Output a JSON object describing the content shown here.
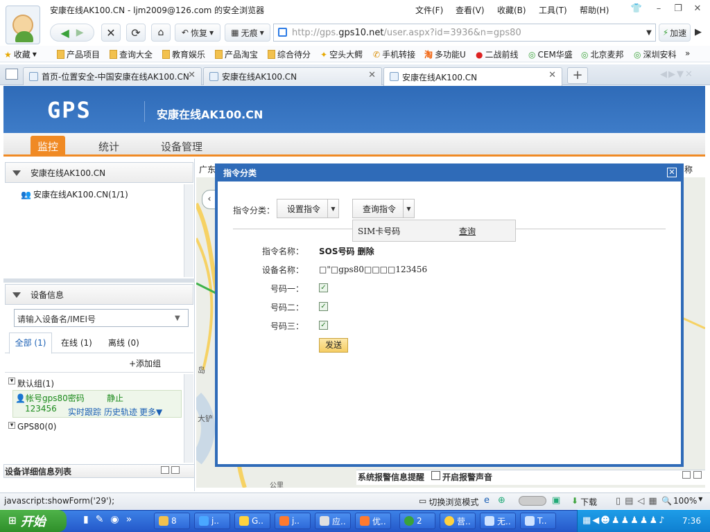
{
  "window": {
    "title": "安康在线AK100.CN - ljm2009@126.com 的安全浏览器",
    "menu": [
      "文件(F)",
      "查看(V)",
      "收藏(B)",
      "工具(T)",
      "帮助(H)"
    ]
  },
  "nav": {
    "restore_label": "恢复",
    "notrace_label": "无痕",
    "url_prefix": "http://gps.",
    "url_domain": "gps10.net",
    "url_path": "/user.aspx?id=3936&n=gps80",
    "accelerate_label": "加速"
  },
  "favorites": {
    "label": "收藏",
    "items": [
      "产品项目",
      "查询大全",
      "教育娱乐",
      "产品淘宝",
      "综合待分",
      "空头大鳄",
      "手机转接",
      "多功能U",
      "二战前线",
      "CEM华盛",
      "北京麦邦",
      "深圳安科"
    ]
  },
  "tabs": [
    {
      "label": "首页-位置安全-中国安康在线AK100.CN"
    },
    {
      "label": "安康在线AK100.CN"
    },
    {
      "label": "安康在线AK100.CN"
    }
  ],
  "page": {
    "logo": "GPS",
    "site_title": "安康在线AK100.CN",
    "nav": [
      "监控",
      "统计",
      "设备管理"
    ]
  },
  "left": {
    "tree_header": "安康在线AK100.CN",
    "tree_item": "安康在线AK100.CN(1/1)",
    "device_header": "设备信息",
    "search_placeholder": "请输入设备名/IMEI号",
    "filters": [
      "全部 (1)",
      "在线 (1)",
      "离线 (0)"
    ],
    "add_group": "+添加组",
    "group_default": "默认组(1)",
    "device_name": "帐号gps80密码",
    "device_id": "123456",
    "device_status": "静止",
    "device_actions": [
      "实时跟踪",
      "历史轨迹",
      "更多▼"
    ],
    "group_gps80": "GPS80(0)",
    "detail_list": "设备详细信息列表"
  },
  "map": {
    "top_text": "广东",
    "top_right_text": "称",
    "labels": [
      "岛",
      "大铲",
      "公里"
    ],
    "alarm_label": "系统报警信息提醒",
    "alarm_sound": "开启报警声音"
  },
  "dialog": {
    "title": "指令分类",
    "category_label": "指令分类：",
    "set_cmd": "设置指令",
    "query_cmd": "查询指令",
    "dropdown_item": "SIM卡号码",
    "dropdown_action": "查询",
    "cmd_name_label": "指令名称：",
    "cmd_name_value": "SOS号码 删除",
    "device_name_label": "设备名称：",
    "device_name_value": "□\"□gps80□□□□123456",
    "num1_label": "号码一：",
    "num2_label": "号码二：",
    "num3_label": "号码三：",
    "send_label": "发送"
  },
  "status": {
    "text": "javascript:showForm('29');",
    "browse_mode": "切换浏览模式",
    "download": "下载",
    "zoom": "100%"
  },
  "taskbar": {
    "start": "开始",
    "tasks": [
      "8",
      "j..",
      "G..",
      "j..",
      "应..",
      "优..",
      "2",
      "营..",
      "无..",
      "T.."
    ],
    "time": "7:36"
  }
}
